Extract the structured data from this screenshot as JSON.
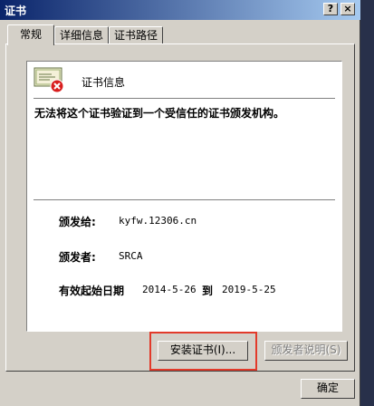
{
  "window": {
    "title": "证书",
    "help_label": "?",
    "close_label": "×"
  },
  "tabs": [
    {
      "label": "常规"
    },
    {
      "label": "详细信息"
    },
    {
      "label": "证书路径"
    }
  ],
  "cert_info": {
    "header": "证书信息",
    "warning": "无法将这个证书验证到一个受信任的证书颁发机构。",
    "issued_to_label": "颁发给:",
    "issued_to_value": "kyfw.12306.cn",
    "issued_by_label": "颁发者:",
    "issued_by_value": "SRCA",
    "validity_label": "有效起始日期",
    "validity_from": "2014-5-26",
    "validity_to_label": "到",
    "validity_to": "2019-5-25"
  },
  "buttons": {
    "install": "安装证书(I)...",
    "issuer_statement": "颁发者说明(S)",
    "ok": "确定"
  },
  "colors": {
    "highlight": "#e23a2a",
    "titlebar": "#0a246a",
    "dialog_bg": "#d4d0c8"
  },
  "icons": {
    "certificate": "certificate-error-icon"
  }
}
